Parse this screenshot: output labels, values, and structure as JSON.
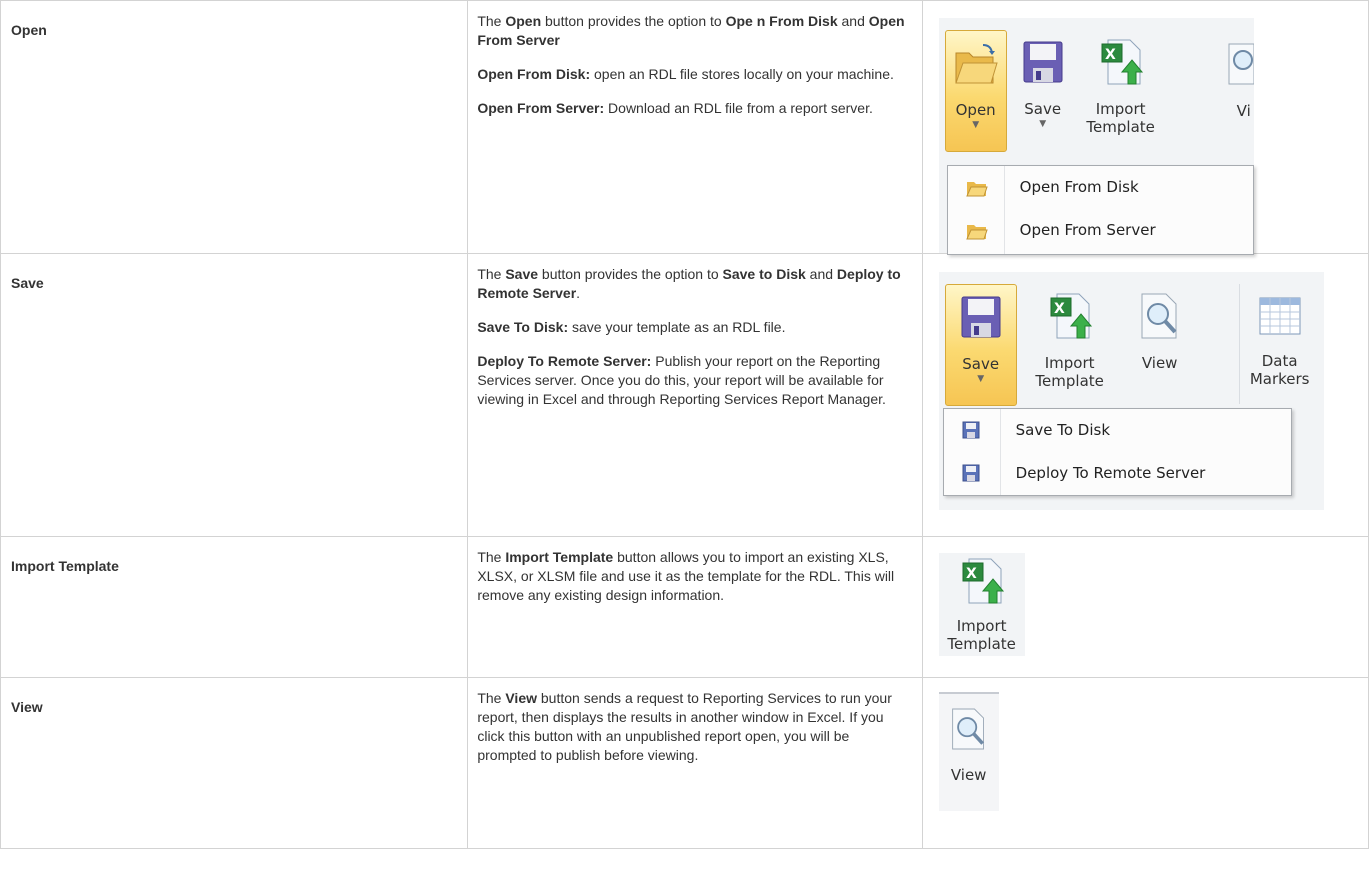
{
  "rows": [
    {
      "name": "Open",
      "paragraphs": [
        [
          {
            "t": "The ",
            "b": false
          },
          {
            "t": "Open",
            "b": true
          },
          {
            "t": " button provides the option to ",
            "b": false
          },
          {
            "t": "Ope n From Disk",
            "b": true
          },
          {
            "t": " and ",
            "b": false
          },
          {
            "t": "Open From Server",
            "b": true
          }
        ],
        [
          {
            "t": "Open From Disk:",
            "b": true
          },
          {
            "t": " open an RDL file stores locally on your machine.",
            "b": false
          }
        ],
        [
          {
            "t": "Open From Server:",
            "b": true
          },
          {
            "t": " Download an RDL file from a report server.",
            "b": false
          }
        ]
      ]
    },
    {
      "name": "Save",
      "paragraphs": [
        [
          {
            "t": "The ",
            "b": false
          },
          {
            "t": "Save",
            "b": true
          },
          {
            "t": " button provides the option to ",
            "b": false
          },
          {
            "t": "Save to Disk",
            "b": true
          },
          {
            "t": " and ",
            "b": false
          },
          {
            "t": "Deploy to Remote Server",
            "b": true
          },
          {
            "t": ".",
            "b": false
          }
        ],
        [
          {
            "t": "Save To Disk:",
            "b": true
          },
          {
            "t": " save your template as an RDL file.",
            "b": false
          }
        ],
        [
          {
            "t": "Deploy To Remote Server:",
            "b": true
          },
          {
            "t": " Publish your report on the Reporting Services server. Once you do this, your report will be available for viewing in Excel and through Reporting Services Report Manager.",
            "b": false
          }
        ]
      ]
    },
    {
      "name": "Import Template",
      "paragraphs": [
        [
          {
            "t": "The ",
            "b": false
          },
          {
            "t": "Import Template",
            "b": true
          },
          {
            "t": " button allows you to import an existing XLS, XLSX, or XLSM file and use it as the template for the RDL. This will remove any existing design information.",
            "b": false
          }
        ]
      ]
    },
    {
      "name": "View",
      "paragraphs": [
        [
          {
            "t": "The ",
            "b": false
          },
          {
            "t": "View",
            "b": true
          },
          {
            "t": " button sends a request to Reporting Services to run your report, then displays the results in another window in Excel. If you click this button with an unpublished report open, you will be prompted to publish before viewing.",
            "b": false
          }
        ]
      ]
    }
  ],
  "ribbon1": {
    "open": "Open",
    "save": "Save",
    "import1": "Import",
    "import2": "Template",
    "view": "Vi",
    "menu": [
      "Open From Disk",
      "Open From Server"
    ]
  },
  "ribbon2": {
    "save": "Save",
    "import1": "Import",
    "import2": "Template",
    "view": "View",
    "markers1": "Data",
    "markers2": "Markers",
    "menu": [
      "Save To Disk",
      "Deploy To Remote Server"
    ]
  },
  "ribbon3": {
    "import1": "Import",
    "import2": "Template"
  },
  "ribbon4": {
    "view": "View"
  },
  "icons": [
    "folder-open-icon",
    "floppy-disk-icon",
    "excel-import-icon",
    "magnifier-view-icon",
    "data-markers-grid-icon"
  ]
}
